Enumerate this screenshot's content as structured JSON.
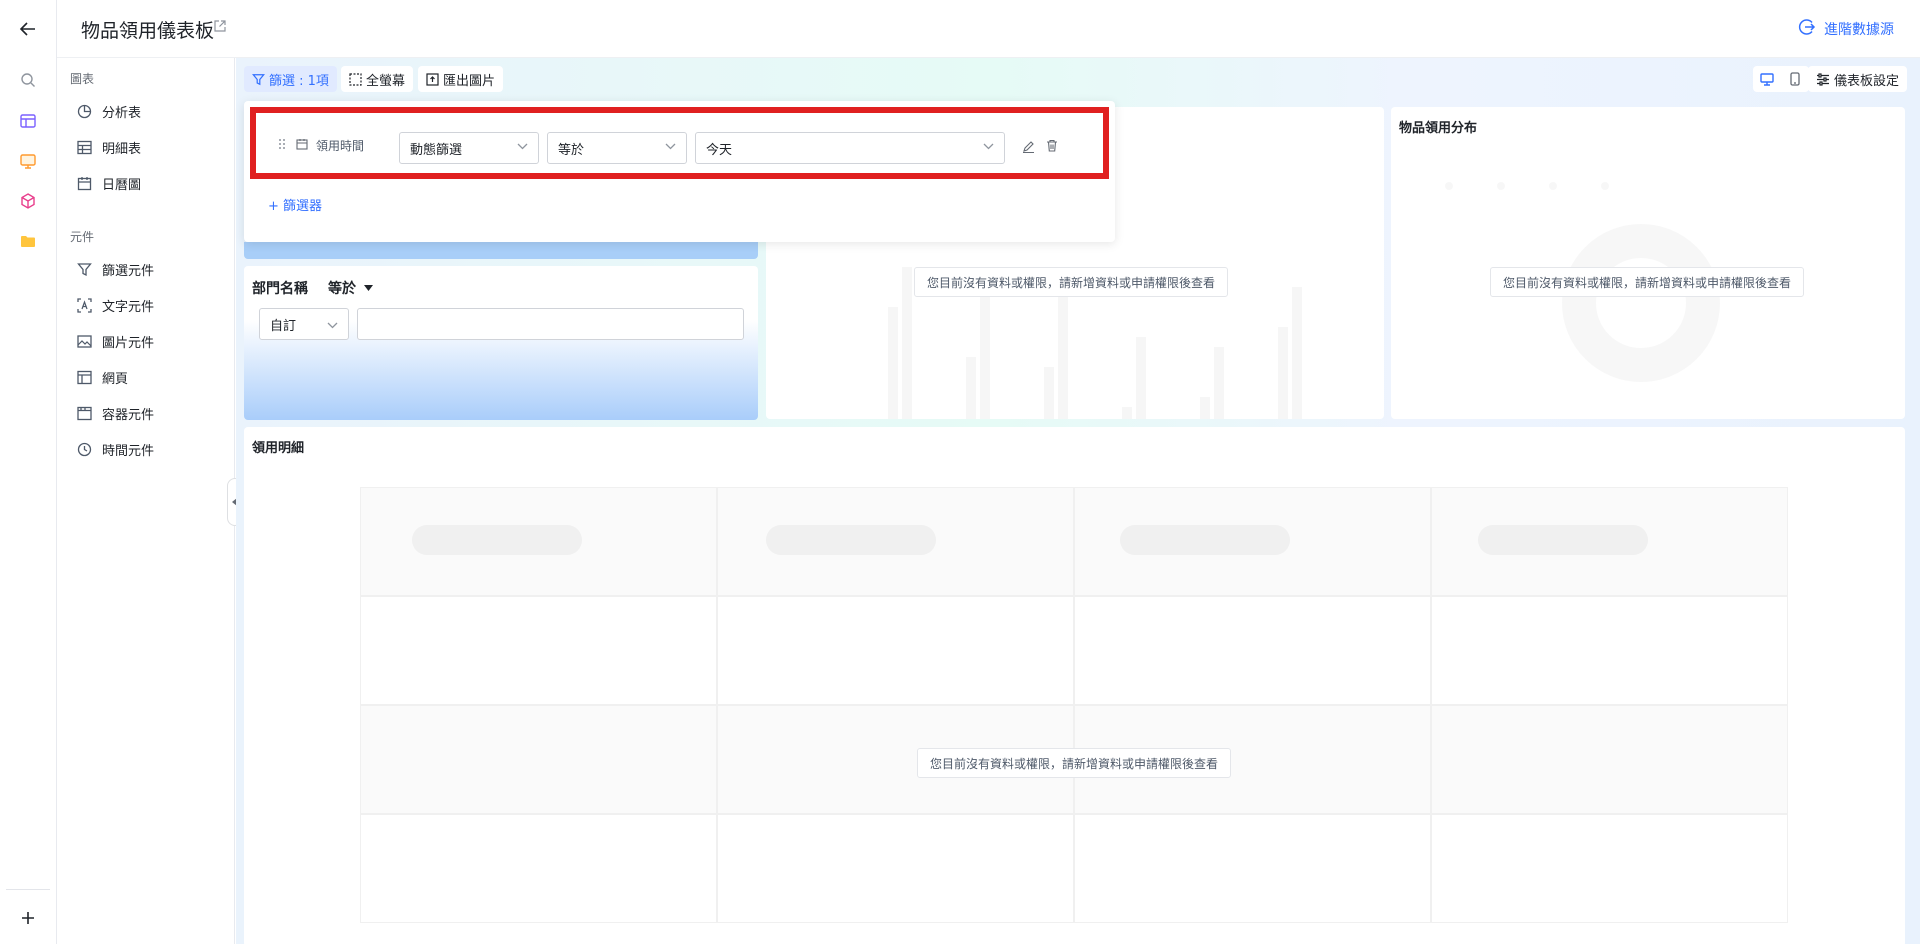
{
  "header": {
    "title": "物品領用儀表板",
    "advanced_source": "進階數據源"
  },
  "panel": {
    "charts_section": "圖表",
    "chart_items": [
      "分析表",
      "明細表",
      "日曆圖"
    ],
    "components_section": "元件",
    "component_items": [
      "篩選元件",
      "文字元件",
      "圖片元件",
      "網頁",
      "容器元件",
      "時間元件"
    ]
  },
  "toolbar": {
    "filter_label": "篩選 : 1項",
    "fullscreen_label": "全螢幕",
    "export_label": "匯出圖片",
    "settings_label": "儀表板設定"
  },
  "filter_popup": {
    "field_name": "領用時間",
    "mode": "動態篩選",
    "operator": "等於",
    "value": "今天",
    "add_label": "+ 篩選器"
  },
  "dept_filter": {
    "field": "部門名稱",
    "operator": "等於",
    "mode": "自訂",
    "input_value": ""
  },
  "bar_card": {
    "title": "",
    "empty_tip": "您目前沒有資料或權限，請新增資料或申請權限後查看"
  },
  "pie_card": {
    "title": "物品領用分布",
    "empty_tip": "您目前沒有資料或權限，請新增資料或申請權限後查看"
  },
  "detail_card": {
    "title": "領用明細",
    "empty_tip": "您目前沒有資料或權限，請新增資料或申請權限後查看"
  },
  "colors": {
    "accent": "#3370ff",
    "highlight_border": "#e02020"
  }
}
